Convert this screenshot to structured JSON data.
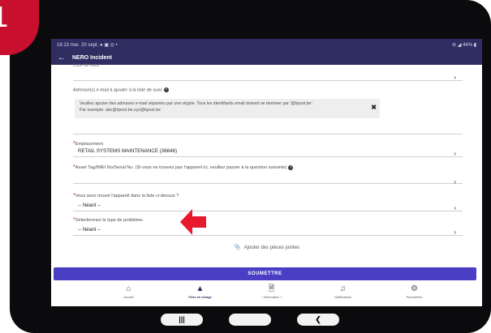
{
  "step_badge": "1",
  "status_bar": {
    "left": "16:13  mer. 20 sept.  ● ▣ ◎ •",
    "right": "⊜ ◢ 44% ▮"
  },
  "app_bar": {
    "back_icon": "arrow-left-icon",
    "title": "NERO Incident"
  },
  "form": {
    "partial_label": "Liste de suivi",
    "email_label": "Adresse(s) e-mail à ajouter à la liste de suivi",
    "email_info_line1": "Veuillez ajouter des adresses e-mail séparées par une virgule. Tous les identifiants email doivent se terminer par '@bpost.be'.",
    "email_info_line2": "Par exemple: abc@bpost.be,xyz@bpost.be",
    "location_label": "Emplacement",
    "location_value": "RETAIL SYSTEMS MAINTENANCE (36848)",
    "asset_label": "Asset Tag/IMEI No/Serial No. (Si vous ne trouvez pas l'appareil ici, veuillez passer à la question suivante)",
    "device_found_label": "Vous avez trouvé l'appareil dans la liste ci-dessus ?",
    "device_found_value": "-- Néant --",
    "problem_type_label": "Sélectionnez le type de problème.",
    "problem_type_value": "-- Néant --",
    "attach_label": "Ajouter des pièces jointes",
    "submit_label": "SOUMETTRE"
  },
  "bottom_nav": [
    {
      "label": "Accueil",
      "icon": "home-icon"
    },
    {
      "label": "Prise en charge",
      "icon": "warning-icon"
    },
    {
      "label": "+ information +",
      "icon": "document-icon"
    },
    {
      "label": "Notifications",
      "icon": "bell-icon"
    },
    {
      "label": "Paramètres",
      "icon": "gear-icon"
    }
  ],
  "colors": {
    "app_bar": "#2f2d62",
    "submit": "#4a3fc4",
    "required_mark": "#c8102e",
    "arrow": "#e8192c"
  }
}
